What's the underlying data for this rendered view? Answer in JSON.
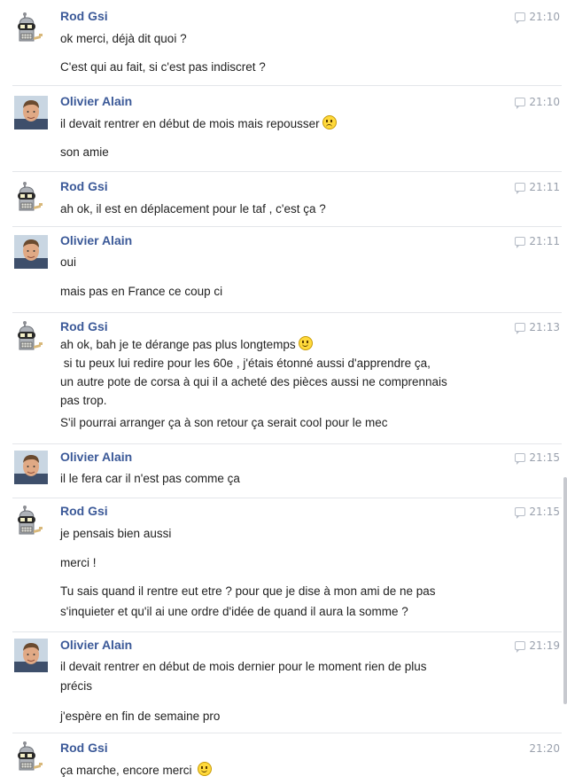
{
  "messages": [
    {
      "sender": "Rod Gsi",
      "avatar": "bender-robot-avatar",
      "time": "21:10",
      "lines": [
        "ok merci, déjà dit quoi ?",
        "C'est qui au fait, si c'est pas indiscret ?"
      ]
    },
    {
      "sender": "Olivier Alain",
      "avatar": "person-photo-avatar",
      "time": "21:10",
      "lines": [
        "il devait rentrer en début de mois mais repousser",
        "son amie"
      ]
    },
    {
      "sender": "Rod Gsi",
      "avatar": "bender-robot-avatar",
      "time": "21:11",
      "lines": [
        "ah ok, il est en déplacement pour le taf , c'est ça ?"
      ]
    },
    {
      "sender": "Olivier Alain",
      "avatar": "person-photo-avatar",
      "time": "21:11",
      "lines": [
        "oui",
        "mais pas en France ce coup ci"
      ]
    },
    {
      "sender": "Rod Gsi",
      "avatar": "bender-robot-avatar",
      "time": "21:13",
      "lines": [
        "ah ok, bah je te dérange pas plus longtemps",
        " si tu peux lui redire pour les 60e , j'étais étonné aussi d'apprendre ça,",
        "un autre pote de corsa à qui il a acheté des pièces aussi ne comprennais",
        "pas trop.",
        "S'il pourrai arranger ça à son retour ça serait cool pour le mec"
      ]
    },
    {
      "sender": "Olivier Alain",
      "avatar": "person-photo-avatar",
      "time": "21:15",
      "lines": [
        "il le fera car il n'est pas comme ça"
      ]
    },
    {
      "sender": "Rod Gsi",
      "avatar": "bender-robot-avatar",
      "time": "21:15",
      "lines": [
        "je pensais bien aussi",
        "merci !",
        "Tu sais quand il rentre eut etre ? pour que je dise à mon ami de ne pas",
        "s'inquieter et qu'il ai une ordre d'idée de quand il aura la somme ?"
      ]
    },
    {
      "sender": "Olivier Alain",
      "avatar": "person-photo-avatar",
      "time": "21:19",
      "lines": [
        "il devait rentrer en début de mois dernier pour le moment rien de plus",
        "précis",
        "j'espère en fin de semaine pro"
      ]
    },
    {
      "sender": "Rod Gsi",
      "avatar": "bender-robot-avatar",
      "time": "21:20",
      "lines": [
        "ça marche, encore merci"
      ]
    }
  ]
}
